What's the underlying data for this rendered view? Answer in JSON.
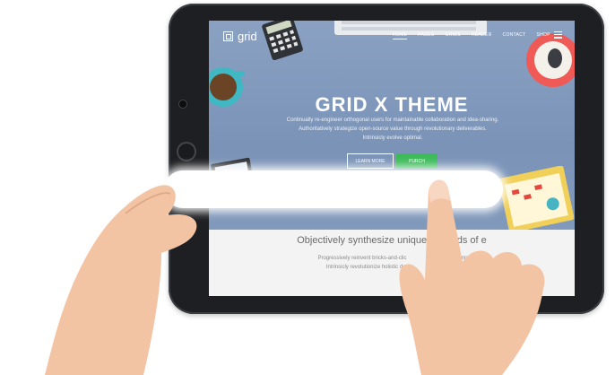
{
  "site": {
    "logo_text": "grid",
    "nav": [
      "HOME",
      "PAGES",
      "GRIDS",
      "HEADER",
      "CONTACT",
      "SHOP"
    ],
    "hero_title": "GRID X THEME",
    "hero_sub_lines": [
      "Continually re-engineer orthogonal users for maintainable collaboration and idea-sharing.",
      "Authoritatively strategize open-source value through revolutionary deliverables.",
      "Intrinsicly evolve optimal."
    ],
    "btn_learn": "LEARN MORE",
    "btn_purchase": "PURCH",
    "section_heading": "Objectively synthesize unique methods of e",
    "section_para_lines": [
      "Progressively reinvent bricks-and-clic",
      "Intrinsicly revolutionize holistic da"
    ],
    "section_para_lines_right": [
      "before imp",
      "real-tim"
    ]
  },
  "colors": {
    "hero_bg": "#7d95b8",
    "purchase_green": "#3dbb5a",
    "tablet_frame": "#1d1f22"
  },
  "icons": [
    "hamburger-icon",
    "coffee-cup-icon",
    "calculator-icon",
    "keyboard-icon",
    "mouse-icon",
    "camera-icon"
  ]
}
